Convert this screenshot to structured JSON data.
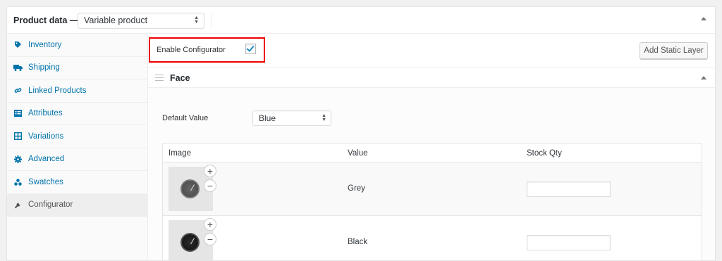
{
  "header": {
    "title": "Product data —",
    "product_type": "Variable product"
  },
  "sidebar": {
    "items": [
      {
        "label": "Inventory",
        "icon": "tag-icon"
      },
      {
        "label": "Shipping",
        "icon": "truck-icon"
      },
      {
        "label": "Linked Products",
        "icon": "link-icon"
      },
      {
        "label": "Attributes",
        "icon": "list-icon"
      },
      {
        "label": "Variations",
        "icon": "grid-icon"
      },
      {
        "label": "Advanced",
        "icon": "gear-icon"
      },
      {
        "label": "Swatches",
        "icon": "dots-icon"
      },
      {
        "label": "Configurator",
        "icon": "wrench-icon",
        "active": true
      }
    ]
  },
  "configurator": {
    "enable_label": "Enable Configurator",
    "enabled": true,
    "add_layer_label": "Add Static Layer",
    "highlight_color": "#e00000"
  },
  "layer": {
    "name": "Face",
    "default_value_label": "Default Value",
    "default_value": "Blue",
    "columns": [
      "Image",
      "Value",
      "Stock Qty"
    ],
    "rows": [
      {
        "value": "Grey",
        "stock_qty": ""
      },
      {
        "value": "Black",
        "stock_qty": ""
      }
    ]
  },
  "colors": {
    "accent": "#0073aa",
    "checkmark": "#1e8cbe"
  }
}
